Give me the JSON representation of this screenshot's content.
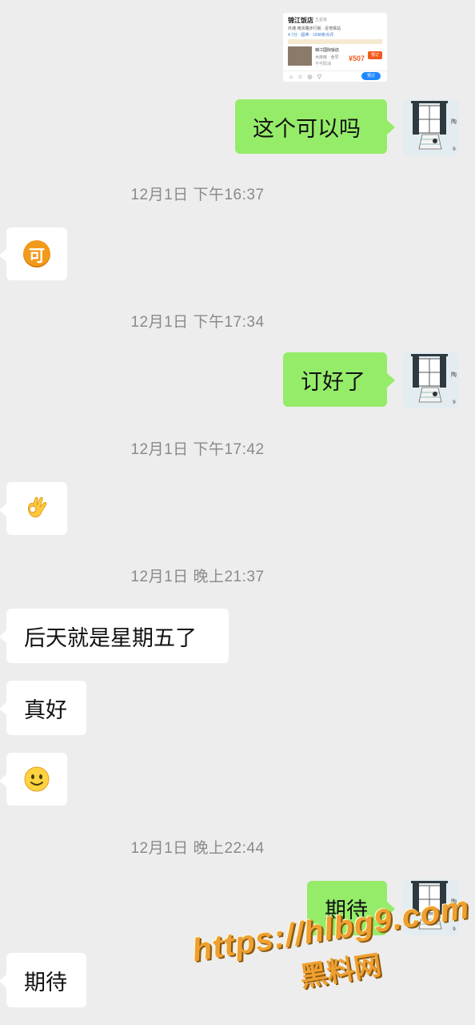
{
  "shared_screenshot": {
    "hotel_name": "锦江饭店",
    "hotel_tag": "五星级",
    "line2": "外滩·南京路步行街 · 近地铁站",
    "line3": "4.7分 · 超棒 · 1598条点评",
    "room_name": "锦江国际饭店",
    "room_desc": "大床房 · 含早",
    "room_note": "不可取消",
    "price": "¥507",
    "button": "预订",
    "bottom_button": "预订"
  },
  "messages": [
    {
      "kind": "out",
      "text": "这个可以吗"
    },
    {
      "kind": "time",
      "text": "12月1日 下午16:37"
    },
    {
      "kind": "in_emoji",
      "emoji": "可"
    },
    {
      "kind": "time",
      "text": "12月1日 下午17:34"
    },
    {
      "kind": "out",
      "text": "订好了"
    },
    {
      "kind": "time",
      "text": "12月1日 下午17:42"
    },
    {
      "kind": "in_emoji",
      "emoji": "ok-hand"
    },
    {
      "kind": "time",
      "text": "12月1日 晚上21:37"
    },
    {
      "kind": "in",
      "text": "后天就是星期五了"
    },
    {
      "kind": "in",
      "text": "真好"
    },
    {
      "kind": "in_emoji",
      "emoji": "smile"
    },
    {
      "kind": "time",
      "text": "12月1日 晚上22:44"
    },
    {
      "kind": "out",
      "text": "期待"
    },
    {
      "kind": "in",
      "text": "期待"
    }
  ],
  "watermark": {
    "url": "https://hlbg9.com",
    "name": "黑料网"
  },
  "colors": {
    "background": "#ededed",
    "outgoing_bubble": "#95ec69",
    "incoming_bubble": "#ffffff",
    "timestamp": "#8a8a8a",
    "watermark": "#f0a030"
  }
}
